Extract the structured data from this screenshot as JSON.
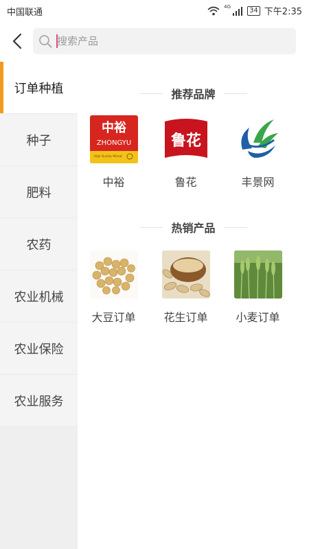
{
  "status_bar": {
    "carrier": "中国联通",
    "network": "4G",
    "battery": "34",
    "time": "下午2:35"
  },
  "search": {
    "placeholder": "搜索产品",
    "value": ""
  },
  "sidebar": {
    "items": [
      {
        "label": "订单种植",
        "active": true
      },
      {
        "label": "种子",
        "active": false
      },
      {
        "label": "肥料",
        "active": false
      },
      {
        "label": "农药",
        "active": false
      },
      {
        "label": "农业机械",
        "active": false
      },
      {
        "label": "农业保险",
        "active": false
      },
      {
        "label": "农业服务",
        "active": false
      }
    ]
  },
  "brands": {
    "title": "推荐品牌",
    "items": [
      {
        "label": "中裕",
        "logo_text": "中裕",
        "logo_sub": "ZHONGYU",
        "logo_small": "High Quality Wheat"
      },
      {
        "label": "鲁花",
        "logo_text": "鲁花"
      },
      {
        "label": "丰景网"
      }
    ]
  },
  "hot": {
    "title": "热销产品",
    "items": [
      {
        "label": "大豆订单",
        "icon": "soybean-photo"
      },
      {
        "label": "花生订单",
        "icon": "peanut-photo"
      },
      {
        "label": "小麦订单",
        "icon": "wheat-photo"
      }
    ]
  },
  "colors": {
    "accent": "#f39a1e",
    "caret": "#e8497a",
    "zhongyu_red": "#d7261f",
    "luhua_red": "#c8141e"
  }
}
